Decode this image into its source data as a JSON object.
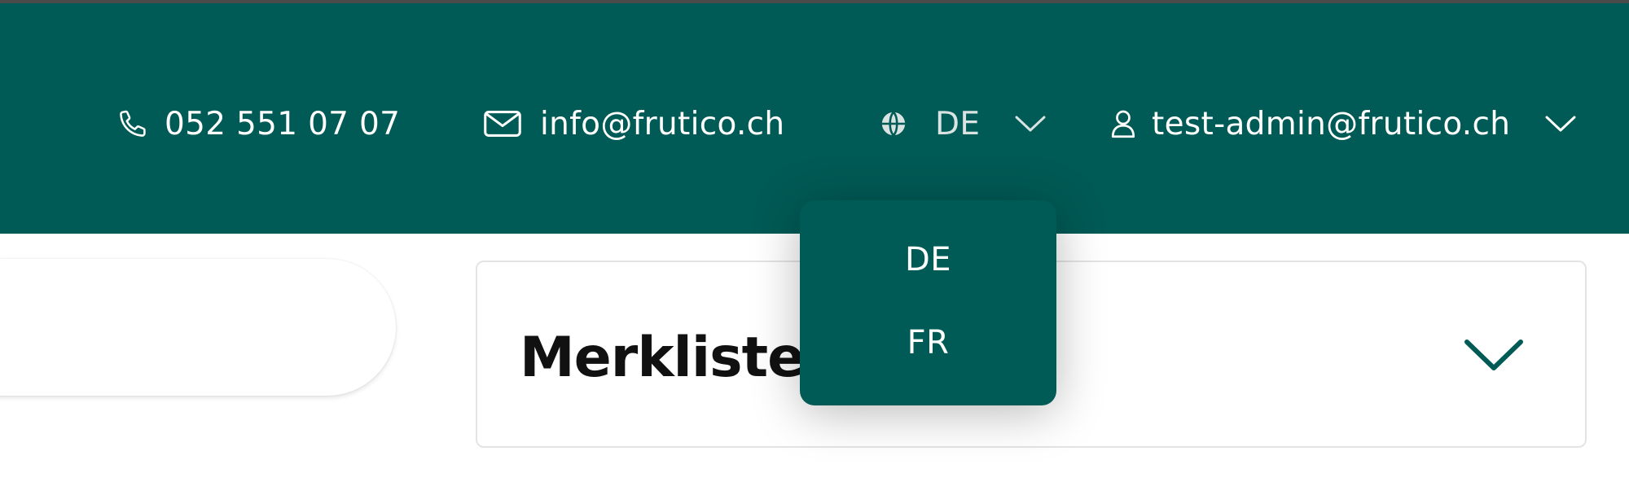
{
  "header": {
    "phone": {
      "icon": "phone-icon",
      "text": "052 551 07 07"
    },
    "email": {
      "icon": "mail-icon",
      "text": "info@frutico.ch"
    },
    "language": {
      "icon": "globe-icon",
      "current": "DE"
    },
    "account": {
      "icon": "user-icon",
      "email": "test-admin@frutico.ch"
    }
  },
  "language_dropdown": {
    "options": [
      "DE",
      "FR"
    ]
  },
  "merkliste": {
    "title": "Merkliste"
  },
  "colors": {
    "brand": "#005a55",
    "text_dark": "#111111",
    "border": "#e4e4e4"
  }
}
